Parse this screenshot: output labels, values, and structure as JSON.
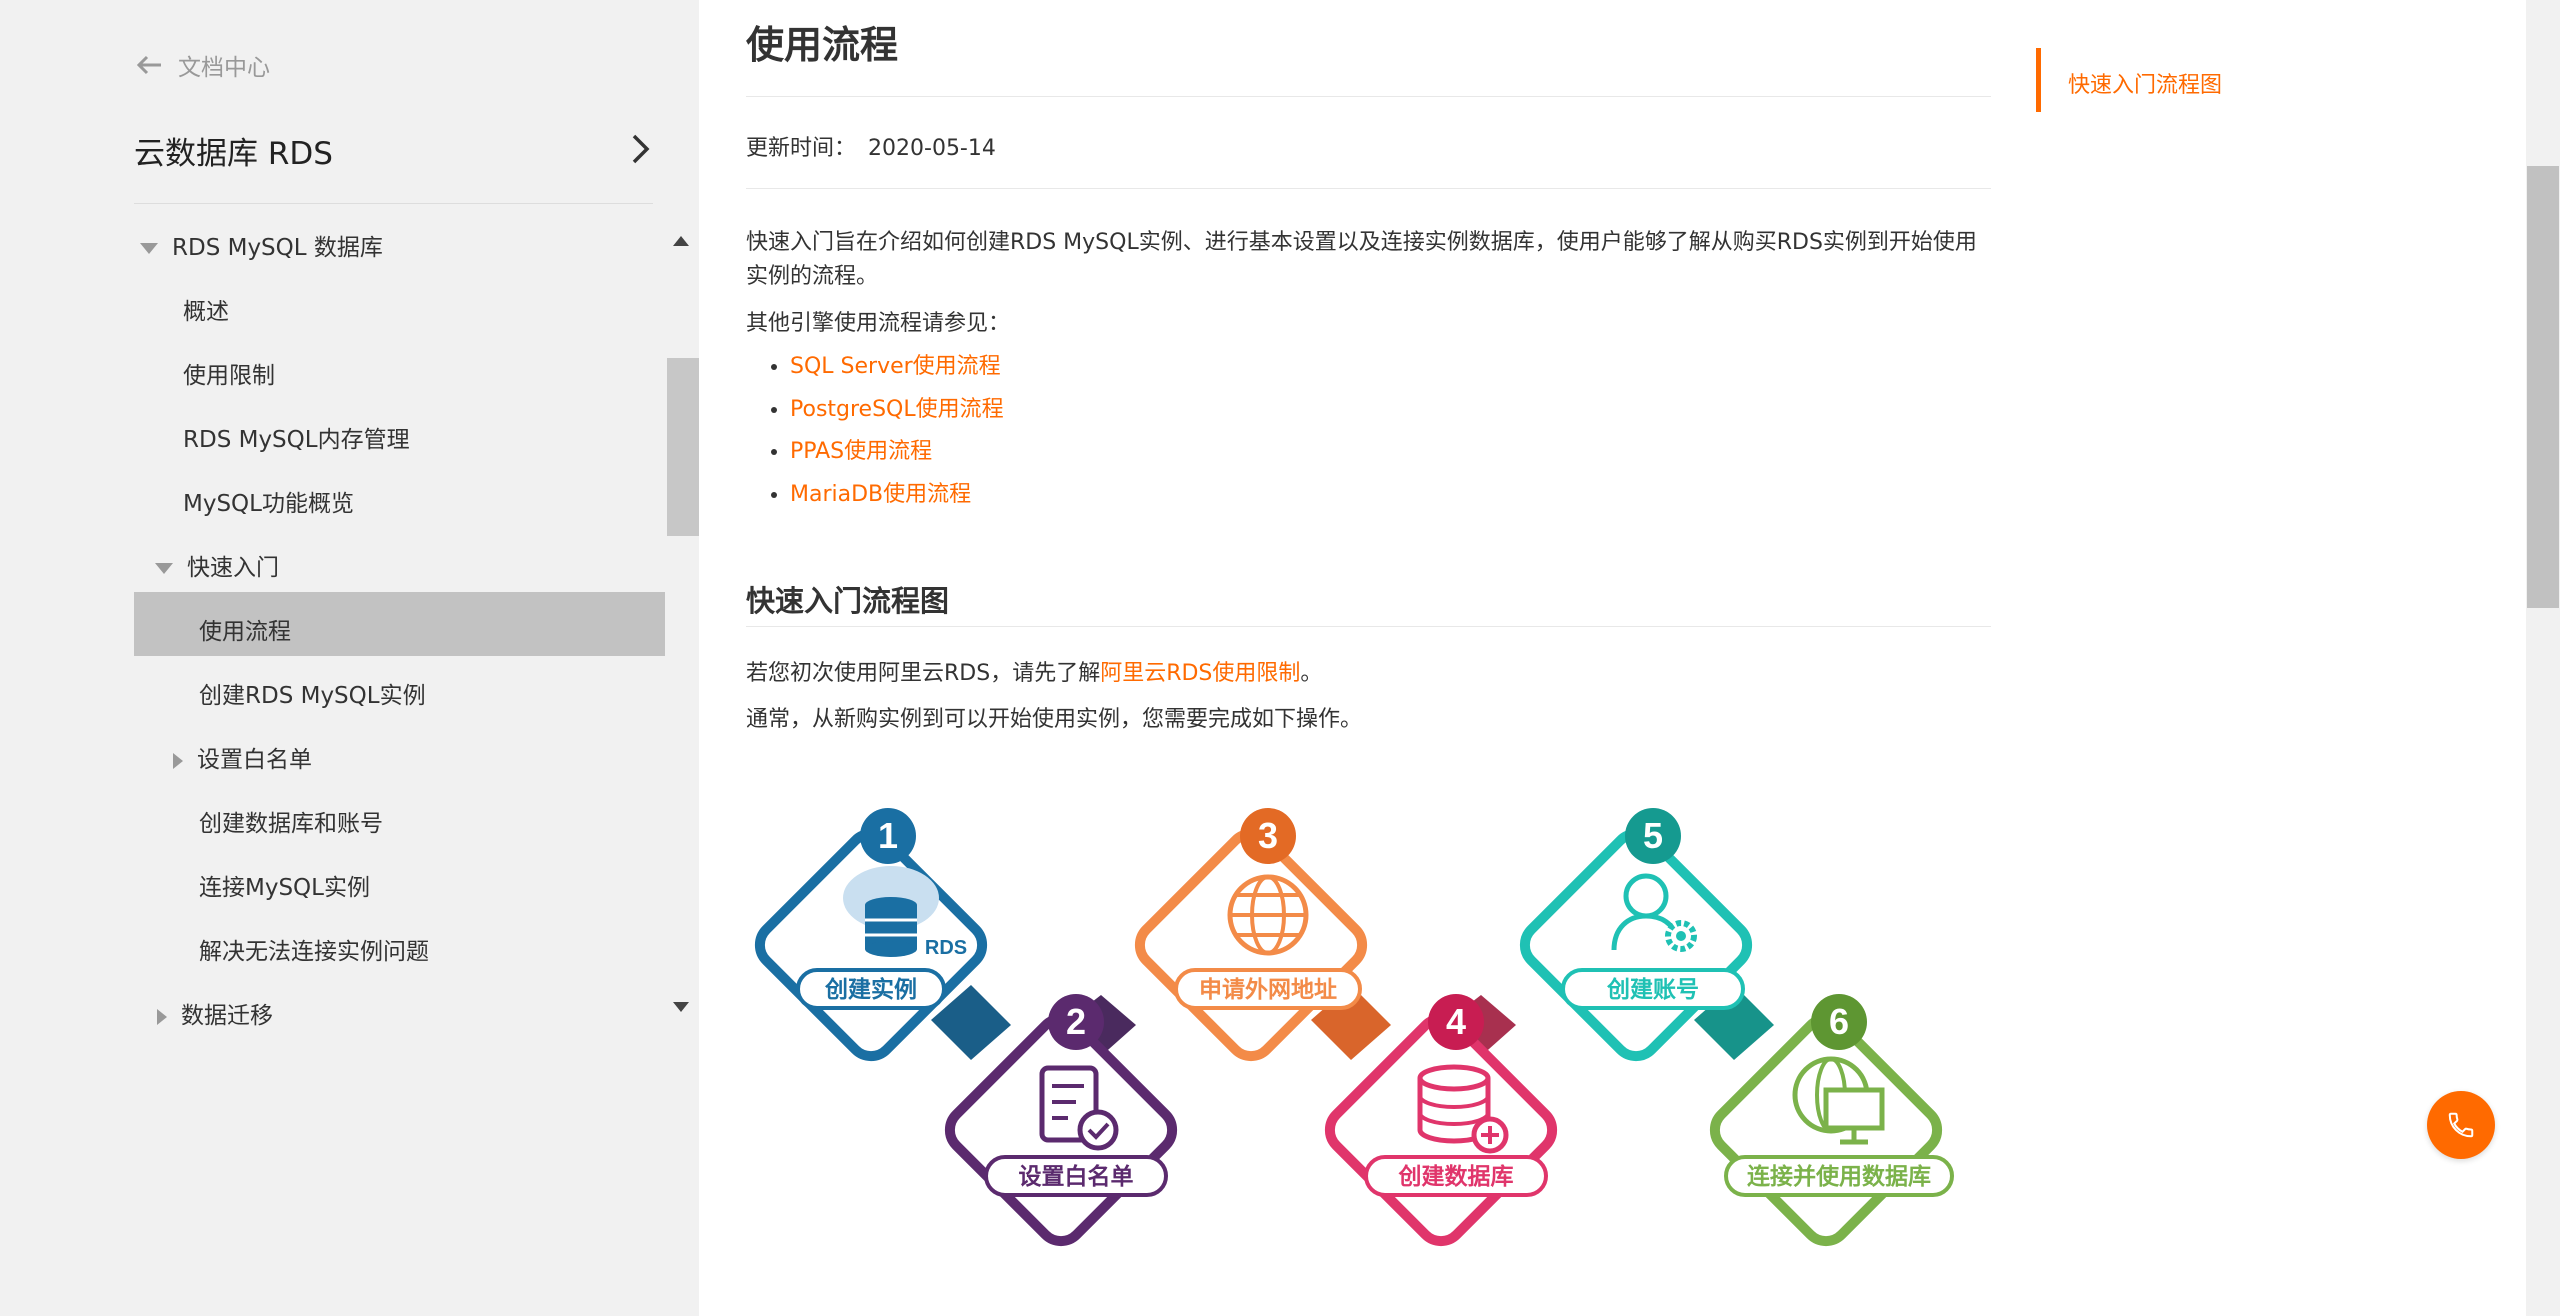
{
  "sidebar": {
    "back_label": "文档中心",
    "product_title": "云数据库 RDS",
    "nav": [
      {
        "label": "RDS MySQL 数据库",
        "expanded": true
      },
      {
        "label": "概述"
      },
      {
        "label": "使用限制"
      },
      {
        "label": "RDS MySQL内存管理"
      },
      {
        "label": "MySQL功能概览"
      },
      {
        "label": "快速入门",
        "expanded": true
      },
      {
        "label": "使用流程",
        "active": true
      },
      {
        "label": "创建RDS MySQL实例"
      },
      {
        "label": "设置白名单",
        "expanded": false
      },
      {
        "label": "创建数据库和账号"
      },
      {
        "label": "连接MySQL实例"
      },
      {
        "label": "解决无法连接实例问题"
      },
      {
        "label": "数据迁移",
        "expanded": false
      }
    ]
  },
  "main": {
    "title": "使用流程",
    "updated_label": "更新时间：",
    "updated_value": "2020-05-14",
    "intro": "快速入门旨在介绍如何创建RDS MySQL实例、进行基本设置以及连接实例数据库，使用户能够了解从购买RDS实例到开始使用实例的流程。",
    "see_also": "其他引擎使用流程请参见：",
    "links": [
      "SQL Server使用流程",
      "PostgreSQL使用流程",
      "PPAS使用流程",
      "MariaDB使用流程"
    ],
    "section_title": "快速入门流程图",
    "p1_pre": "若您初次使用阿里云RDS，请先了解",
    "p1_link": "阿里云RDS使用限制",
    "p1_post": "。",
    "p2": "通常，从新购实例到可以开始使用实例，您需要完成如下操作。",
    "flow": {
      "steps": [
        {
          "num": "1",
          "label": "创建实例",
          "color": "#1a6fa3",
          "icon": "cloud-database-icon",
          "icon_text": "RDS"
        },
        {
          "num": "2",
          "label": "设置白名单",
          "color": "#5b2a6e",
          "icon": "checklist-icon"
        },
        {
          "num": "3",
          "label": "申请外网地址",
          "color": "#f38b48",
          "icon": "globe-icon"
        },
        {
          "num": "4",
          "label": "创建数据库",
          "color": "#e0356b",
          "icon": "database-add-icon"
        },
        {
          "num": "5",
          "label": "创建账号",
          "color": "#1fc1b4",
          "icon": "user-settings-icon"
        },
        {
          "num": "6",
          "label": "连接并使用数据库",
          "color": "#7bb24a",
          "icon": "globe-monitor-icon"
        }
      ]
    }
  },
  "toc": {
    "items": [
      "快速入门流程图"
    ]
  },
  "colors": {
    "accent": "#ff6a00"
  }
}
